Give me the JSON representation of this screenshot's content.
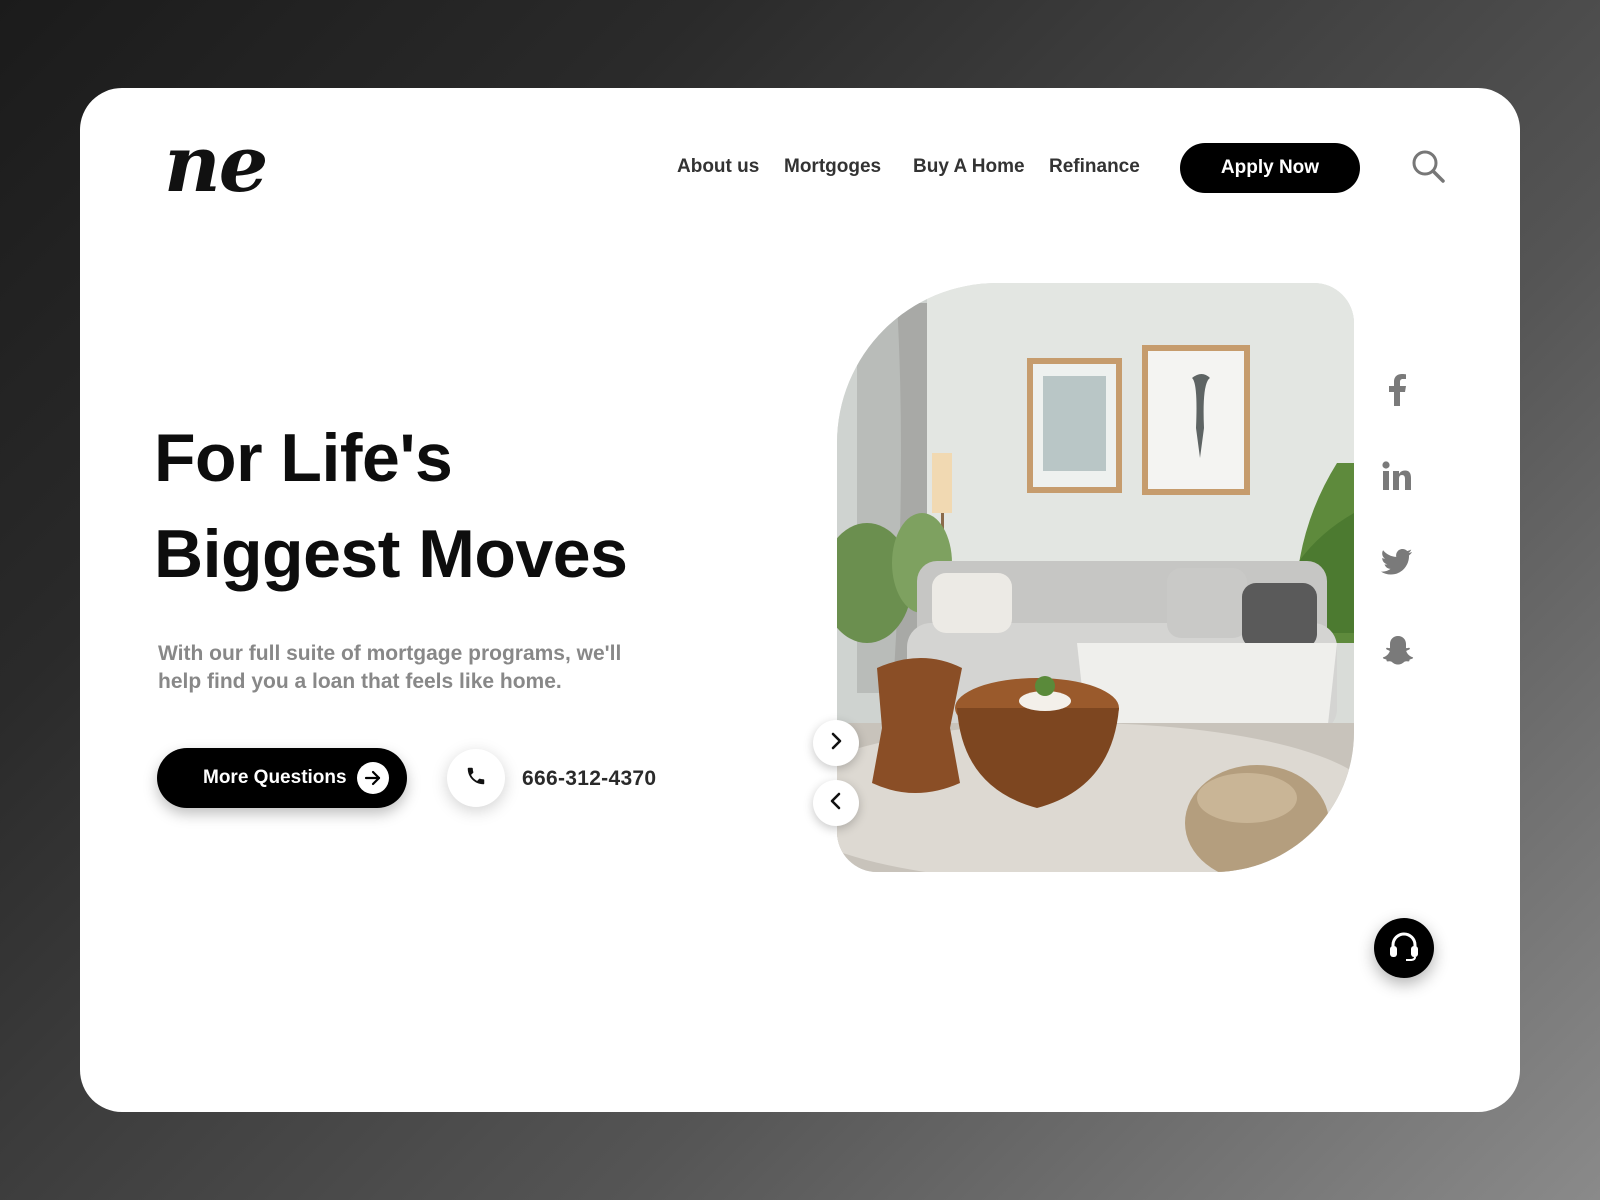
{
  "brand": {
    "logo_text": "ne"
  },
  "nav": {
    "items": [
      {
        "label": "About us"
      },
      {
        "label": "Mortgoges"
      },
      {
        "label": "Buy A Home"
      },
      {
        "label": "Refinance"
      }
    ],
    "cta_label": "Apply Now"
  },
  "hero": {
    "title_line1": "For Life's",
    "title_line2": "Biggest Moves",
    "description": "With our full suite of mortgage programs, we'll help find you a loan that feels like home.",
    "primary_button_label": "More Questions",
    "phone_number": "666-312-4370"
  },
  "social": [
    "facebook-icon",
    "linkedin-icon",
    "twitter-icon",
    "snapchat-icon"
  ],
  "colors": {
    "primary": "#000000",
    "muted_text": "#888888",
    "icon_gray": "#7a7a7a"
  }
}
